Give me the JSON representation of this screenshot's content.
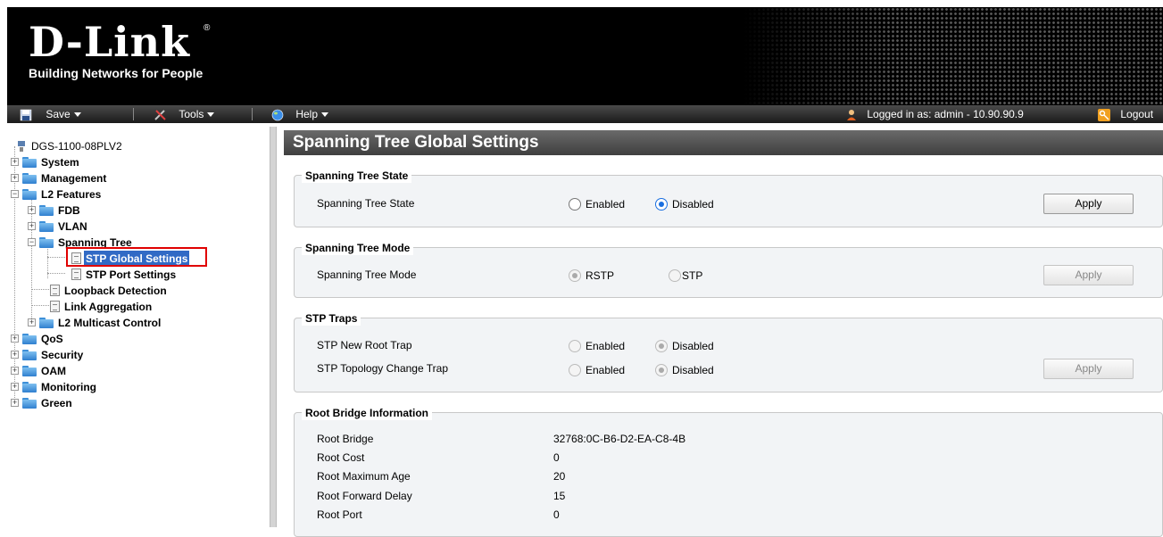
{
  "header": {
    "brand": "D-Link",
    "registered": "®",
    "tagline": "Building Networks for People"
  },
  "menubar": {
    "save_label": "Save",
    "tools_label": "Tools",
    "help_label": "Help",
    "logged_in_text": "Logged in as: admin - 10.90.90.9",
    "logout_label": "Logout"
  },
  "tree": {
    "device": "DGS-1100-08PLV2",
    "system": "System",
    "management": "Management",
    "l2_features": "L2 Features",
    "fdb": "FDB",
    "vlan": "VLAN",
    "spanning_tree": "Spanning Tree",
    "stp_global": "STP Global Settings",
    "stp_port": "STP Port Settings",
    "loopback": "Loopback Detection",
    "link_agg": "Link Aggregation",
    "l2_multicast": "L2 Multicast Control",
    "qos": "QoS",
    "security": "Security",
    "oam": "OAM",
    "monitoring": "Monitoring",
    "green": "Green"
  },
  "page": {
    "title": "Spanning Tree Global Settings"
  },
  "state_panel": {
    "legend": "Spanning Tree State",
    "label": "Spanning Tree State",
    "opt_enabled": "Enabled",
    "opt_disabled": "Disabled",
    "selected": "Disabled",
    "apply": "Apply"
  },
  "mode_panel": {
    "legend": "Spanning Tree Mode",
    "label": "Spanning Tree Mode",
    "opt_rstp": "RSTP",
    "opt_stp": "STP",
    "selected": "RSTP",
    "apply": "Apply"
  },
  "traps_panel": {
    "legend": "STP Traps",
    "new_root_label": "STP New Root Trap",
    "topology_label": "STP Topology Change Trap",
    "opt_enabled": "Enabled",
    "opt_disabled": "Disabled",
    "new_root_selected": "Disabled",
    "topology_selected": "Disabled",
    "apply": "Apply"
  },
  "root_panel": {
    "legend": "Root Bridge Information",
    "rows": [
      {
        "label": "Root Bridge",
        "value": "32768:0C-B6-D2-EA-C8-4B"
      },
      {
        "label": "Root Cost",
        "value": "0"
      },
      {
        "label": "Root Maximum Age",
        "value": "20"
      },
      {
        "label": "Root Forward Delay",
        "value": "15"
      },
      {
        "label": "Root Port",
        "value": "0"
      }
    ]
  }
}
